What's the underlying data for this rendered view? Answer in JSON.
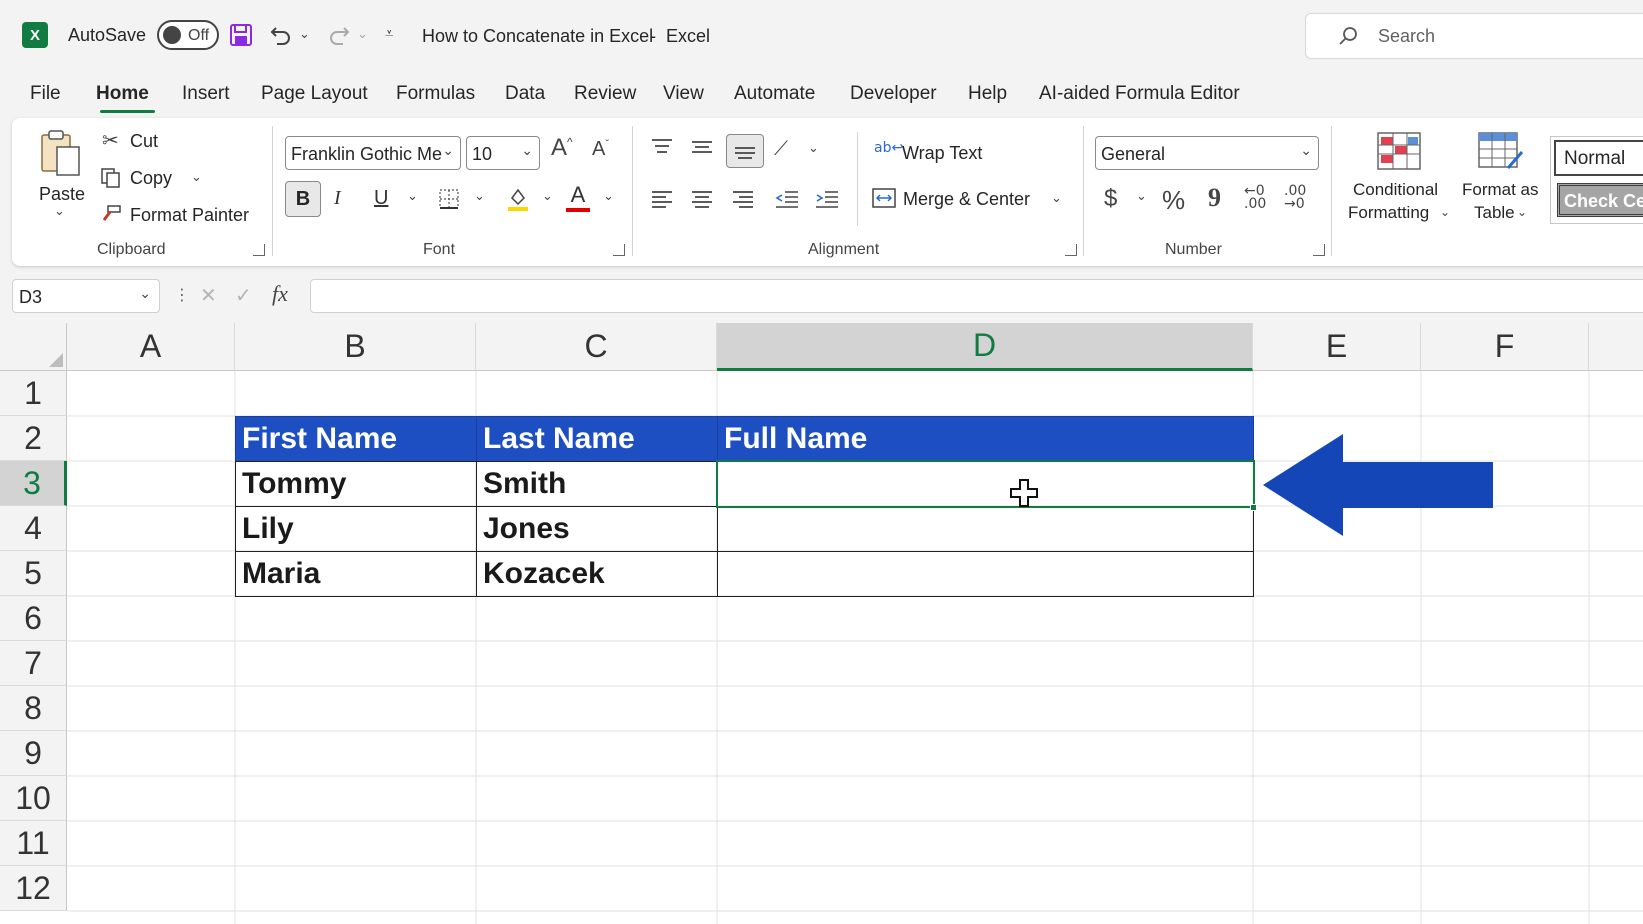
{
  "titlebar": {
    "autosave_label": "AutoSave",
    "autosave_state": "Off",
    "doc_title": "How to Concatenate in Excel",
    "separator": "-",
    "app_name": "Excel",
    "search_placeholder": "Search"
  },
  "menu": {
    "tabs": [
      "File",
      "Home",
      "Insert",
      "Page Layout",
      "Formulas",
      "Data",
      "Review",
      "View",
      "Automate",
      "Developer",
      "Help",
      "AI-aided Formula Editor"
    ],
    "active": "Home"
  },
  "ribbon": {
    "clipboard": {
      "paste": "Paste",
      "cut": "Cut",
      "copy": "Copy",
      "format_painter": "Format Painter",
      "group": "Clipboard"
    },
    "font": {
      "font_name": "Franklin Gothic Me",
      "font_size": "10",
      "bold": "B",
      "italic": "I",
      "underline": "U",
      "group": "Font"
    },
    "alignment": {
      "wrap_text": "Wrap Text",
      "merge_center": "Merge & Center",
      "group": "Alignment"
    },
    "number": {
      "format": "General",
      "currency": "$",
      "percent": "%",
      "comma": "9",
      "group": "Number"
    },
    "styles": {
      "conditional": "Conditional",
      "formatting": "Formatting",
      "format_as": "Format as",
      "table": "Table",
      "normal": "Normal",
      "check_cell": "Check Ce"
    }
  },
  "formula_bar": {
    "name_box": "D3",
    "fx": "fx",
    "content": ""
  },
  "grid": {
    "columns": [
      "A",
      "B",
      "C",
      "D",
      "E",
      "F"
    ],
    "selected_column": "D",
    "rows": [
      "1",
      "2",
      "3",
      "4",
      "5",
      "6",
      "7",
      "8",
      "9",
      "10",
      "11",
      "12"
    ],
    "selected_row": "3",
    "table_headers": [
      "First Name",
      "Last Name",
      "Full Name"
    ],
    "table_rows": [
      [
        "Tommy",
        "Smith",
        ""
      ],
      [
        "Lily",
        "Jones",
        ""
      ],
      [
        "Maria",
        "Kozacek",
        ""
      ]
    ]
  },
  "colors": {
    "excel_green": "#107c41",
    "header_fill": "#1e4fc2",
    "arrow": "#1446b8"
  }
}
